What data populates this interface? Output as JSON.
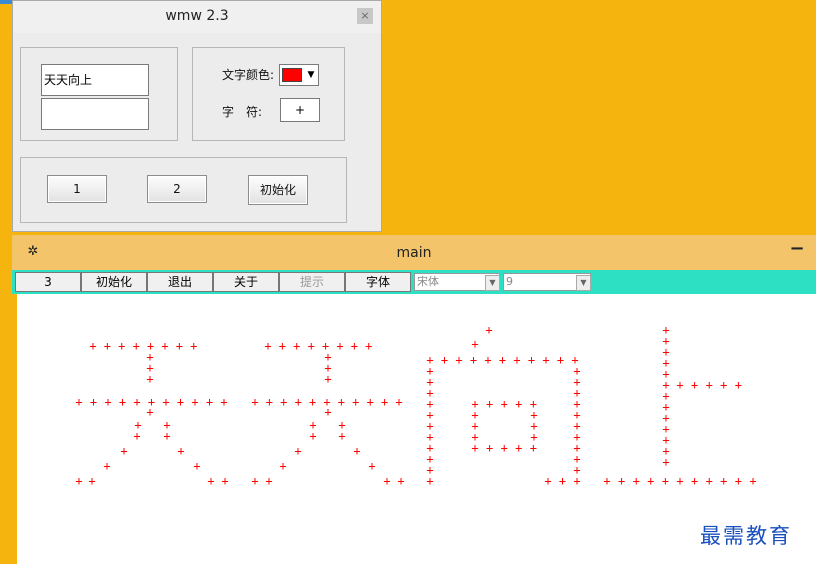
{
  "dialog": {
    "title": "wmw 2.3",
    "close_glyph": "×",
    "text_value": "天天向上",
    "color_label": "文字颜色:",
    "char_label": "字　符:",
    "char_value": "+",
    "selected_color": "#ff0000",
    "button_1": "1",
    "button_2": "2",
    "init_button": "初始化"
  },
  "main": {
    "title": "main",
    "app_icon": "app-icon",
    "minimize_glyph": "−",
    "toolbar": {
      "btn_3": "3",
      "init": "初始化",
      "exit": "退出",
      "about": "关于",
      "hint": "提示",
      "font": "字体",
      "font_name": "宋体",
      "font_size": "9"
    },
    "banner_char": "+",
    "banner_color": "#ff0000",
    "watermark": "最需教育"
  },
  "colors": {
    "desktop": "#F6B40F",
    "main_titlebar": "#F3C46A",
    "toolbar": "#2de0c4"
  }
}
